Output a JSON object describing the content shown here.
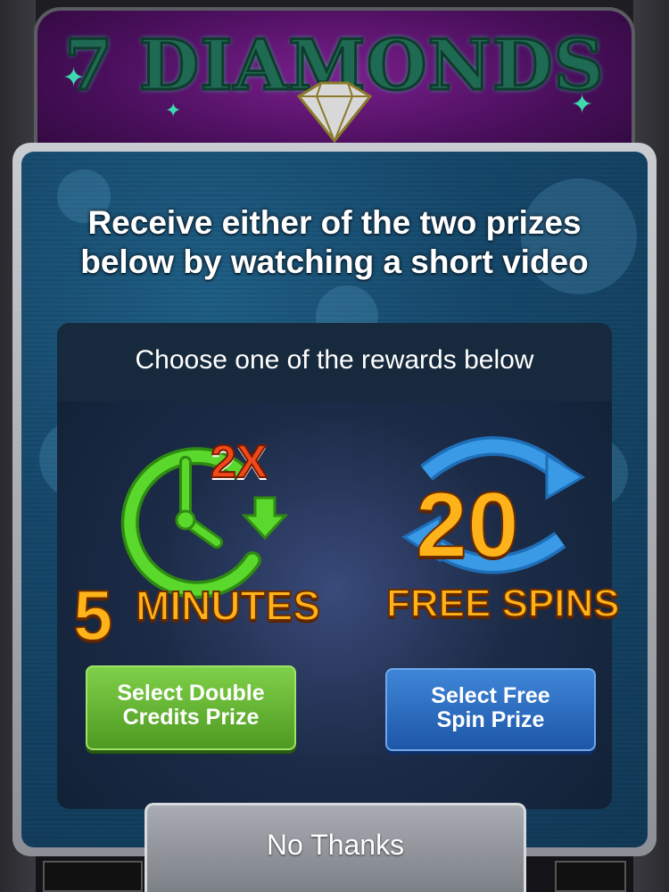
{
  "background": {
    "game_title": "7 DIAMONDS"
  },
  "modal": {
    "headline_line1": "Receive either of the two prizes",
    "headline_line2": "below by watching a short video",
    "choose_text": "Choose one of the rewards below"
  },
  "rewards": [
    {
      "multiplier_badge": "2X",
      "big_number": "5",
      "label": "MINUTES",
      "button_line1": "Select Double",
      "button_line2": "Credits Prize",
      "icon": "clock-icon"
    },
    {
      "big_number": "20",
      "label": "FREE SPINS",
      "button_line1": "Select Free",
      "button_line2": "Spin Prize",
      "icon": "spin-arrows-icon"
    }
  ],
  "footer": {
    "no_thanks_label": "No Thanks"
  },
  "colors": {
    "green_button": "#5fae2e",
    "blue_button": "#2a6cc0",
    "reward_text": "#ffb31a",
    "clock_green": "#5ad82c",
    "badge_red": "#f04a1a"
  }
}
